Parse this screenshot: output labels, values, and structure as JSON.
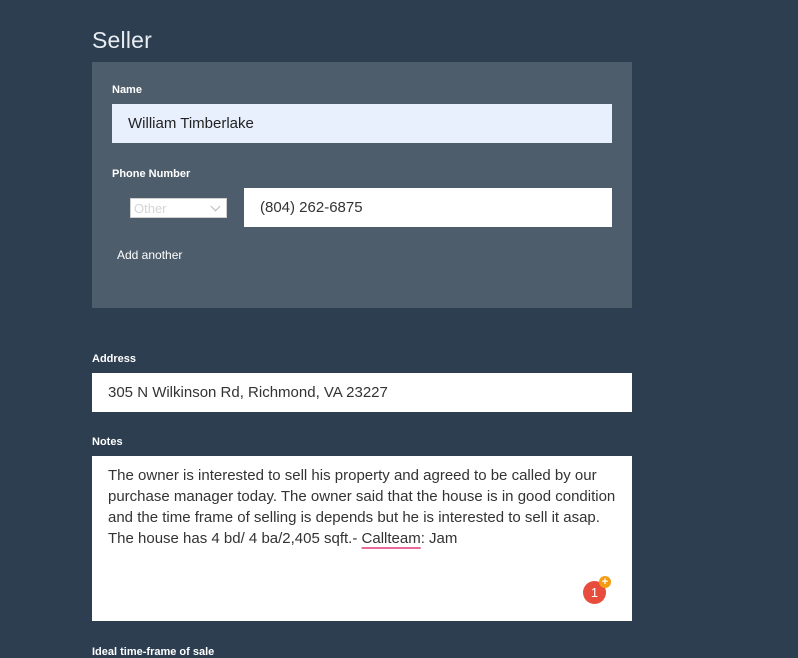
{
  "seller": {
    "section_title": "Seller",
    "name_label": "Name",
    "name_value": "William Timberlake",
    "phone_label": "Phone Number",
    "phone_type_selected": "Other",
    "phone_value": "(804) 262-6875",
    "add_another_label": "Add another"
  },
  "address": {
    "label": "Address",
    "value": "305 N Wilkinson Rd, Richmond, VA 23227"
  },
  "notes": {
    "label": "Notes",
    "text_before_highlight": "The owner is interested to sell his property and agreed to be called by our purchase manager today. The owner said that the house is in good condition and the time frame of selling is depends but he is interested to sell it asap. The house has 4 bd/ 4 ba/2,405 sqft.- ",
    "highlighted_word": "Callteam",
    "text_after_highlight": ": Jam",
    "badge_count": "1",
    "badge_plus": "+"
  },
  "next_section": {
    "label": "Ideal time-frame of sale"
  },
  "colors": {
    "page_background": "#2c3e50",
    "panel_background": "#4e5d6c",
    "autofill_background": "#e8f0fe",
    "badge_red": "#e74c3c",
    "badge_orange": "#f39c12",
    "spellcheck_underline": "#e86b9a"
  }
}
